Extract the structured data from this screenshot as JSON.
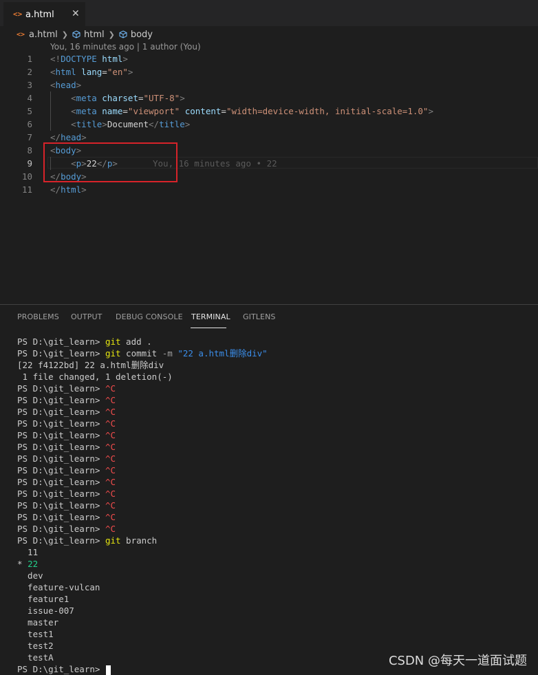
{
  "tab": {
    "icon": "<>",
    "label": "a.html",
    "close": "✕"
  },
  "breadcrumb": {
    "file": "a.html",
    "items": [
      "html",
      "body"
    ]
  },
  "blame_header": "You, 16 minutes ago | 1 author (You)",
  "editor": {
    "lines": [
      {
        "n": "1",
        "tokens": [
          [
            "p",
            "<!"
          ],
          [
            "t",
            "DOCTYPE"
          ],
          [
            "x",
            " "
          ],
          [
            "a",
            "html"
          ],
          [
            "p",
            ">"
          ]
        ]
      },
      {
        "n": "2",
        "tokens": [
          [
            "p",
            "<"
          ],
          [
            "t",
            "html"
          ],
          [
            "x",
            " "
          ],
          [
            "a",
            "lang"
          ],
          [
            "x",
            "="
          ],
          [
            "s",
            "\"en\""
          ],
          [
            "p",
            ">"
          ]
        ]
      },
      {
        "n": "3",
        "tokens": [
          [
            "p",
            "<"
          ],
          [
            "t",
            "head"
          ],
          [
            "p",
            ">"
          ]
        ]
      },
      {
        "n": "4",
        "tokens": [
          [
            "x",
            "    "
          ],
          [
            "p",
            "<"
          ],
          [
            "t",
            "meta"
          ],
          [
            "x",
            " "
          ],
          [
            "a",
            "charset"
          ],
          [
            "x",
            "="
          ],
          [
            "s",
            "\"UTF-8\""
          ],
          [
            "p",
            ">"
          ]
        ]
      },
      {
        "n": "5",
        "tokens": [
          [
            "x",
            "    "
          ],
          [
            "p",
            "<"
          ],
          [
            "t",
            "meta"
          ],
          [
            "x",
            " "
          ],
          [
            "a",
            "name"
          ],
          [
            "x",
            "="
          ],
          [
            "s",
            "\"viewport\""
          ],
          [
            "x",
            " "
          ],
          [
            "a",
            "content"
          ],
          [
            "x",
            "="
          ],
          [
            "s",
            "\"width=device-width, initial-scale=1.0\""
          ],
          [
            "p",
            ">"
          ]
        ]
      },
      {
        "n": "6",
        "tokens": [
          [
            "x",
            "    "
          ],
          [
            "p",
            "<"
          ],
          [
            "t",
            "title"
          ],
          [
            "p",
            ">"
          ],
          [
            "x",
            "Document"
          ],
          [
            "p",
            "</"
          ],
          [
            "t",
            "title"
          ],
          [
            "p",
            ">"
          ]
        ]
      },
      {
        "n": "7",
        "tokens": [
          [
            "p",
            "</"
          ],
          [
            "t",
            "head"
          ],
          [
            "p",
            ">"
          ]
        ]
      },
      {
        "n": "8",
        "tokens": [
          [
            "p",
            "<"
          ],
          [
            "t",
            "body"
          ],
          [
            "p",
            ">"
          ]
        ]
      },
      {
        "n": "9",
        "tokens": [
          [
            "x",
            "    "
          ],
          [
            "p",
            "<"
          ],
          [
            "t",
            "p"
          ],
          [
            "p",
            ">"
          ],
          [
            "x",
            "22"
          ],
          [
            "p",
            "</"
          ],
          [
            "t",
            "p"
          ],
          [
            "p",
            ">"
          ]
        ]
      },
      {
        "n": "10",
        "tokens": [
          [
            "p",
            "</"
          ],
          [
            "t",
            "body"
          ],
          [
            "p",
            ">"
          ]
        ]
      },
      {
        "n": "11",
        "tokens": [
          [
            "p",
            "</"
          ],
          [
            "t",
            "html"
          ],
          [
            "p",
            ">"
          ]
        ]
      }
    ],
    "active_line": "9",
    "inline_blame": "You, 16 minutes ago • 22"
  },
  "panel_tabs": [
    "PROBLEMS",
    "OUTPUT",
    "DEBUG CONSOLE",
    "TERMINAL",
    "GITLENS"
  ],
  "active_panel_tab": "TERMINAL",
  "terminal": [
    [
      [
        "x",
        "PS D:\\git_learn> "
      ],
      [
        "y",
        "git"
      ],
      [
        "x",
        " add ."
      ]
    ],
    [
      [
        "x",
        "PS D:\\git_learn> "
      ],
      [
        "y",
        "git"
      ],
      [
        "x",
        " commit "
      ],
      [
        "g",
        "-m"
      ],
      [
        "x",
        " "
      ],
      [
        "b",
        "\"22 a.html删除div\""
      ]
    ],
    [
      [
        "x",
        "[22 f4122bd] 22 a.html删除div"
      ]
    ],
    [
      [
        "x",
        " 1 file changed, 1 deletion(-)"
      ]
    ],
    [
      [
        "x",
        "PS D:\\git_learn> "
      ],
      [
        "r",
        "^C"
      ]
    ],
    [
      [
        "x",
        "PS D:\\git_learn> "
      ],
      [
        "r",
        "^C"
      ]
    ],
    [
      [
        "x",
        "PS D:\\git_learn> "
      ],
      [
        "r",
        "^C"
      ]
    ],
    [
      [
        "x",
        "PS D:\\git_learn> "
      ],
      [
        "r",
        "^C"
      ]
    ],
    [
      [
        "x",
        "PS D:\\git_learn> "
      ],
      [
        "r",
        "^C"
      ]
    ],
    [
      [
        "x",
        "PS D:\\git_learn> "
      ],
      [
        "r",
        "^C"
      ]
    ],
    [
      [
        "x",
        "PS D:\\git_learn> "
      ],
      [
        "r",
        "^C"
      ]
    ],
    [
      [
        "x",
        "PS D:\\git_learn> "
      ],
      [
        "r",
        "^C"
      ]
    ],
    [
      [
        "x",
        "PS D:\\git_learn> "
      ],
      [
        "r",
        "^C"
      ]
    ],
    [
      [
        "x",
        "PS D:\\git_learn> "
      ],
      [
        "r",
        "^C"
      ]
    ],
    [
      [
        "x",
        "PS D:\\git_learn> "
      ],
      [
        "r",
        "^C"
      ]
    ],
    [
      [
        "x",
        "PS D:\\git_learn> "
      ],
      [
        "r",
        "^C"
      ]
    ],
    [
      [
        "x",
        "PS D:\\git_learn> "
      ],
      [
        "r",
        "^C"
      ]
    ],
    [
      [
        "x",
        "PS D:\\git_learn> "
      ],
      [
        "y",
        "git"
      ],
      [
        "x",
        " branch"
      ]
    ],
    [
      [
        "x",
        "  11"
      ]
    ],
    [
      [
        "x",
        "* "
      ],
      [
        "n",
        "22"
      ]
    ],
    [
      [
        "x",
        "  dev"
      ]
    ],
    [
      [
        "x",
        "  feature-vulcan"
      ]
    ],
    [
      [
        "x",
        "  feature1"
      ]
    ],
    [
      [
        "x",
        "  issue-007"
      ]
    ],
    [
      [
        "x",
        "  master"
      ]
    ],
    [
      [
        "x",
        "  test1"
      ]
    ],
    [
      [
        "x",
        "  test2"
      ]
    ],
    [
      [
        "x",
        "  testA"
      ]
    ],
    [
      [
        "x",
        "PS D:\\git_learn> "
      ]
    ]
  ],
  "watermark": "CSDN @每天一道面试题",
  "colors": {
    "keyword_yellow": "#e5e510",
    "ctrl_c_red": "#f14c4c",
    "string_blue": "#3b8eea",
    "branch_green": "#23d18b",
    "highlight_box": "#d8232a"
  }
}
